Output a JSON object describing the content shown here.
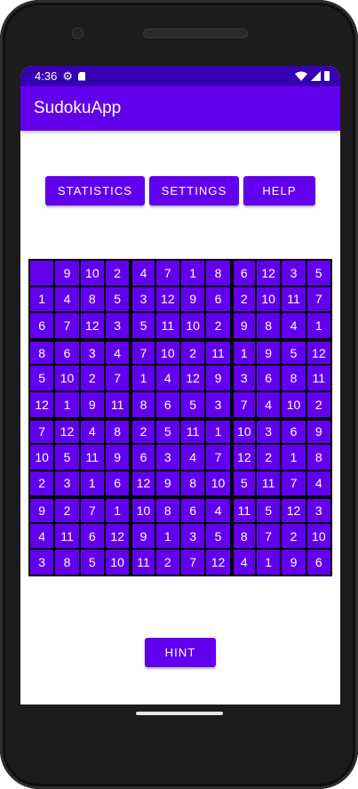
{
  "status_bar": {
    "time": "4:36",
    "icons": [
      "gear-icon",
      "sd-card-icon",
      "wifi-icon",
      "cell-signal-icon",
      "battery-icon"
    ]
  },
  "app_bar": {
    "title": "SudokuApp"
  },
  "buttons": {
    "statistics": "STATISTICS",
    "settings": "SETTINGS",
    "help": "HELP",
    "hint": "HINT"
  },
  "colors": {
    "primary": "#6200ee",
    "primary_dark": "#3700b3",
    "grid_line": "#000000"
  },
  "board": {
    "size": 12,
    "box_rows": 3,
    "box_cols": 4,
    "rows": [
      [
        "",
        "9",
        "10",
        "2",
        "4",
        "7",
        "1",
        "8",
        "6",
        "12",
        "3",
        "5"
      ],
      [
        "1",
        "4",
        "8",
        "5",
        "3",
        "12",
        "9",
        "6",
        "2",
        "10",
        "11",
        "7"
      ],
      [
        "6",
        "7",
        "12",
        "3",
        "5",
        "11",
        "10",
        "2",
        "9",
        "8",
        "4",
        "1"
      ],
      [
        "8",
        "6",
        "3",
        "4",
        "7",
        "10",
        "2",
        "11",
        "1",
        "9",
        "5",
        "12"
      ],
      [
        "5",
        "10",
        "2",
        "7",
        "1",
        "4",
        "12",
        "9",
        "3",
        "6",
        "8",
        "11"
      ],
      [
        "12",
        "1",
        "9",
        "11",
        "8",
        "6",
        "5",
        "3",
        "7",
        "4",
        "10",
        "2"
      ],
      [
        "7",
        "12",
        "4",
        "8",
        "2",
        "5",
        "11",
        "1",
        "10",
        "3",
        "6",
        "9"
      ],
      [
        "10",
        "5",
        "11",
        "9",
        "6",
        "3",
        "4",
        "7",
        "12",
        "2",
        "1",
        "8"
      ],
      [
        "2",
        "3",
        "1",
        "6",
        "12",
        "9",
        "8",
        "10",
        "5",
        "11",
        "7",
        "4"
      ],
      [
        "9",
        "2",
        "7",
        "1",
        "10",
        "8",
        "6",
        "4",
        "11",
        "5",
        "12",
        "3"
      ],
      [
        "4",
        "11",
        "6",
        "12",
        "9",
        "1",
        "3",
        "5",
        "8",
        "7",
        "2",
        "10"
      ],
      [
        "3",
        "8",
        "5",
        "10",
        "11",
        "2",
        "7",
        "12",
        "4",
        "1",
        "9",
        "6"
      ]
    ]
  }
}
